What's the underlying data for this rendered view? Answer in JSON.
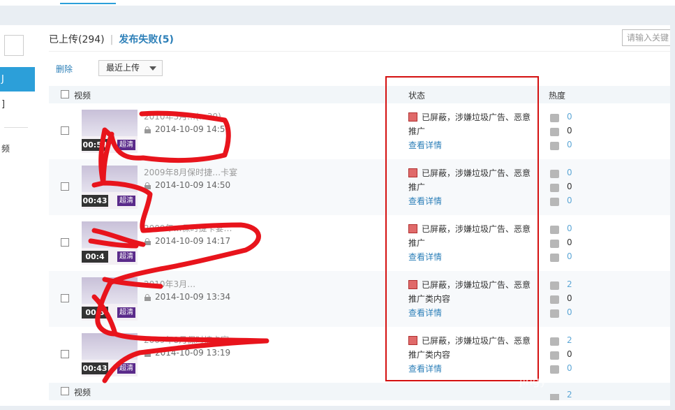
{
  "tabs": {
    "uploaded": "已上传(294)",
    "separator": "|",
    "failed": "发布失败(5)"
  },
  "search": {
    "placeholder": "请输入关键"
  },
  "sidebar": {
    "active_label": "J",
    "item_2": "]",
    "item_3": "频"
  },
  "toolbar": {
    "delete_label": "删除",
    "sort_value": "最近上传"
  },
  "table": {
    "headers": {
      "video": "视频",
      "status": "状态",
      "heat": "热度"
    },
    "rows": [
      {
        "title": "2010年3月…(…39)",
        "date": "2014-10-09 14:52",
        "duration": "00:54",
        "hd": "超清",
        "status_text": "已屏蔽，涉嫌垃圾广告、恶意推广",
        "detail": "查看详情",
        "plays": "0",
        "comments": "0",
        "shares": "0"
      },
      {
        "title": "2009年8月保时捷…卡宴",
        "date": "2014-10-09 14:50",
        "duration": "00:43",
        "hd": "超清",
        "status_text": "已屏蔽，涉嫌垃圾广告、恶意推广",
        "detail": "查看详情",
        "plays": "0",
        "comments": "0",
        "shares": "0"
      },
      {
        "title": "2009年…保时捷卡宴…",
        "date": "2014-10-09 14:17",
        "duration": "00:4",
        "hd": "超清",
        "status_text": "已屏蔽，涉嫌垃圾广告、恶意推广",
        "detail": "查看详情",
        "plays": "0",
        "comments": "0",
        "shares": "0"
      },
      {
        "title": "2010年3月…",
        "date": "2014-10-09 13:34",
        "duration": "00:5",
        "hd": "超清",
        "status_text": "已屏蔽，涉嫌垃圾广告、恶意推广类内容",
        "detail": "查看详情",
        "plays": "2",
        "comments": "0",
        "shares": "0"
      },
      {
        "title": "2009年8月保时捷卡宴",
        "date": "2014-10-09 13:19",
        "duration": "00:43",
        "hd": "超清",
        "status_text": "已屏蔽，涉嫌垃圾广告、恶意推广类内容",
        "detail": "查看详情",
        "plays": "2",
        "comments": "0",
        "shares": "0"
      }
    ],
    "footer_header": "视频",
    "footer_heat": "2"
  },
  "watermark": "jingy",
  "colors": {
    "accent": "#2c9fd9",
    "link": "#2c7fb8",
    "highlight": "#d41010",
    "scribble": "#e8141c"
  }
}
